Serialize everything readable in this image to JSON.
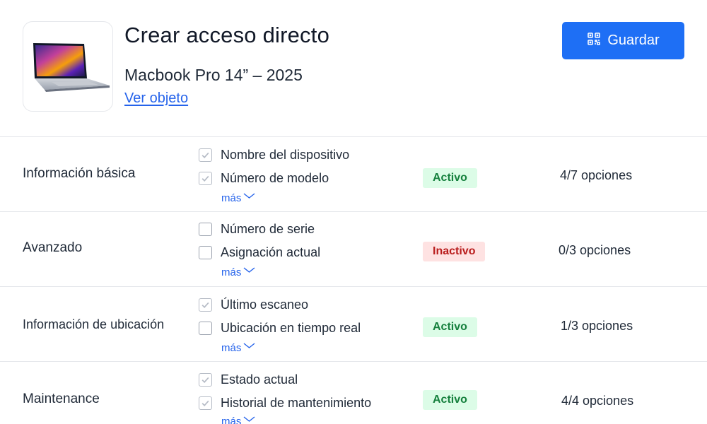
{
  "header": {
    "title": "Crear acceso directo",
    "product_name": "Macbook Pro 14” – 2025",
    "view_link": "Ver objeto",
    "save_label": "Guardar"
  },
  "sections": [
    {
      "label": "Información básica",
      "options": [
        {
          "label": "Nombre del dispositivo",
          "checked": true
        },
        {
          "label": "Número de modelo",
          "checked": true
        }
      ],
      "more": "más",
      "status": "Activo",
      "count": "4/7 opciones"
    },
    {
      "label": "Avanzado",
      "options": [
        {
          "label": "Número de serie",
          "checked": false
        },
        {
          "label": "Asignación actual",
          "checked": false
        }
      ],
      "more": "más",
      "status": "Inactivo",
      "count": "0/3 opciones"
    },
    {
      "label": "Información de ubicación",
      "options": [
        {
          "label": "Último escaneo",
          "checked": true
        },
        {
          "label": "Ubicación en tiempo real",
          "checked": false
        }
      ],
      "more": "más",
      "status": "Activo",
      "count": "1/3 opciones"
    },
    {
      "label": "Maintenance",
      "options": [
        {
          "label": "Estado actual",
          "checked": true
        },
        {
          "label": "Historial de mantenimiento",
          "checked": true
        }
      ],
      "more": "más",
      "status": "Activo",
      "count": "4/4 opciones"
    }
  ],
  "colors": {
    "primary": "#1e6ff5",
    "link": "#2563eb",
    "active_bg": "#dcfce7",
    "active_text": "#15803d",
    "inactive_bg": "#fee2e2",
    "inactive_text": "#b91c1c"
  },
  "icons": {
    "save": "qr-code-icon",
    "more": "chevron-down-icon",
    "checkbox": "check-icon"
  }
}
